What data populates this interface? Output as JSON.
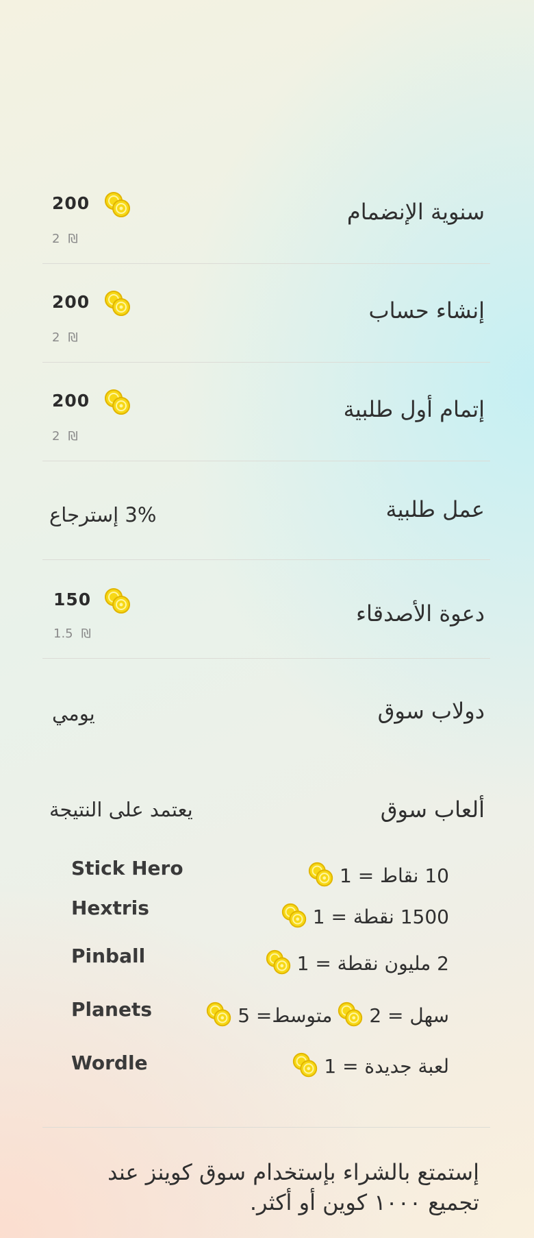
{
  "rewards": [
    {
      "title": "سنوية الإنضمام",
      "amount": "200",
      "value": "2",
      "currency": "₪"
    },
    {
      "title": "إنشاء حساب",
      "amount": "200",
      "value": "2",
      "currency": "₪"
    },
    {
      "title": "إتمام أول طلبية",
      "amount": "200",
      "value": "2",
      "currency": "₪"
    },
    {
      "title": "عمل طلبية",
      "text": "3% إسترجاع"
    },
    {
      "title": "دعوة الأصدقاء",
      "amount": "150",
      "value": "1.5",
      "currency": "₪"
    },
    {
      "title": "دولاب سوق",
      "text": "يومي"
    },
    {
      "title": "ألعاب سوق",
      "text": "يعتمد على النتيجة"
    }
  ],
  "games": [
    {
      "name": "Stick Hero",
      "rate_pre": "10 نقاط = 1",
      "rate_post": ""
    },
    {
      "name": "Hextris",
      "rate_pre": "1500 نقطة = 1",
      "rate_post": ""
    },
    {
      "name": "Pinball",
      "rate_pre": "2 مليون نقطة = 1",
      "rate_post": ""
    },
    {
      "name": "Planets",
      "rate_pre": "سهل = 2",
      "rate_mid": "متوسط= 5",
      "rate_post": ""
    },
    {
      "name": "Wordle",
      "rate_pre": "لعبة جديدة = 1",
      "rate_post": ""
    }
  ],
  "footer": "إستمتع بالشراء بإستخدام سوق كوينز عند تجميع ١٠٠٠ كوين أو أكثر.",
  "icons": {
    "coin": "coin-stack-icon"
  },
  "colors": {
    "coin": "#f6d40a",
    "coin_dark": "#e3b800",
    "divider": "#dcdcd6"
  }
}
